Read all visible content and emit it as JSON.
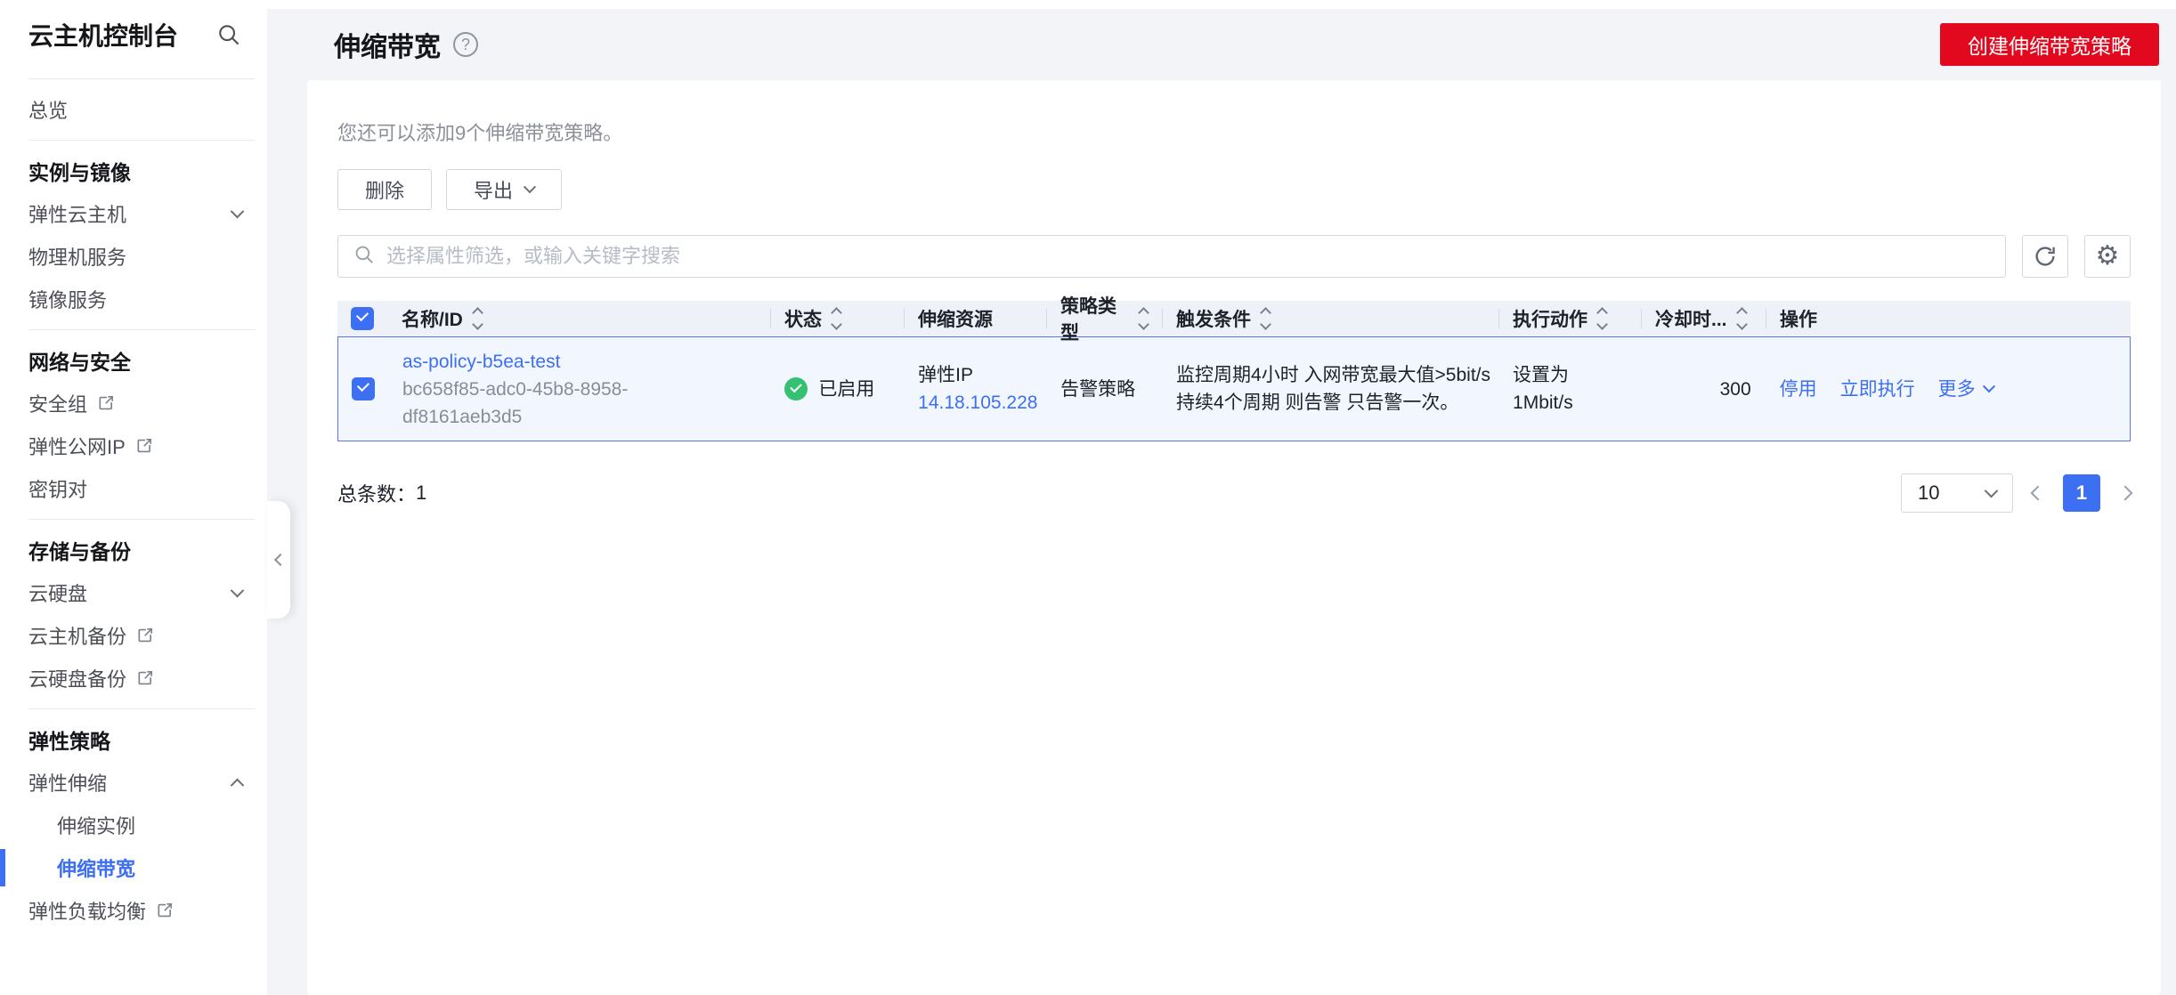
{
  "colors": {
    "brand_red": "#e2091f",
    "accent_blue": "#3d6ff2",
    "selected_row_border": "#5b77e3",
    "selected_row_bg": "#f2f6ff",
    "status_green": "#34c272",
    "table_header_bg": "#eef1f8",
    "page_bg": "#f2f4f8"
  },
  "sidebar": {
    "title": "云主机控制台",
    "groups": [
      {
        "items": [
          {
            "label": "总览"
          }
        ]
      },
      {
        "header": "实例与镜像",
        "items": [
          {
            "label": "弹性云主机"
          },
          {
            "label": "物理机服务"
          },
          {
            "label": "镜像服务"
          }
        ]
      },
      {
        "header": "网络与安全",
        "items": [
          {
            "label": "安全组"
          },
          {
            "label": "弹性公网IP"
          },
          {
            "label": "密钥对"
          }
        ]
      },
      {
        "header": "存储与备份",
        "items": [
          {
            "label": "云硬盘"
          },
          {
            "label": "云主机备份"
          },
          {
            "label": "云硬盘备份"
          }
        ]
      },
      {
        "header": "弹性策略",
        "items": [
          {
            "label": "弹性伸缩"
          },
          {
            "label": "伸缩实例"
          },
          {
            "label": "伸缩带宽"
          },
          {
            "label": "弹性负载均衡"
          }
        ]
      }
    ]
  },
  "header": {
    "title": "伸缩带宽",
    "create_button": "创建伸缩带宽策略"
  },
  "toolbar": {
    "quota_hint": "您还可以添加9个伸缩带宽策略。",
    "delete_button": "删除",
    "export_button": "导出"
  },
  "search": {
    "placeholder": "选择属性筛选，或输入关键字搜索"
  },
  "table": {
    "columns": [
      {
        "label": "名称/ID",
        "sortable": true
      },
      {
        "label": "状态",
        "sortable": true
      },
      {
        "label": "伸缩资源",
        "sortable": false
      },
      {
        "label": "策略类型",
        "sortable": true
      },
      {
        "label": "触发条件",
        "sortable": true
      },
      {
        "label": "执行动作",
        "sortable": true
      },
      {
        "label": "冷却时...",
        "sortable": true
      },
      {
        "label": "操作",
        "sortable": false
      }
    ],
    "rows": [
      {
        "name": "as-policy-b5ea-test",
        "id": "bc658f85-adc0-45b8-8958-df8161aeb3d5",
        "status": "已启用",
        "resource_type": "弹性IP",
        "resource_ip": "14.18.105.228",
        "policy_type": "告警策略",
        "trigger_condition": "监控周期4小时 入网带宽最大值>5bit/s 持续4个周期 则告警 只告警一次。",
        "action_line1": "设置为",
        "action_line2": "1Mbit/s",
        "cooldown": "300",
        "op_disable": "停用",
        "op_execute": "立即执行",
        "op_more": "更多"
      }
    ]
  },
  "pagination": {
    "total_label": "总条数：",
    "total": "1",
    "page_size": "10",
    "current_page": "1"
  }
}
